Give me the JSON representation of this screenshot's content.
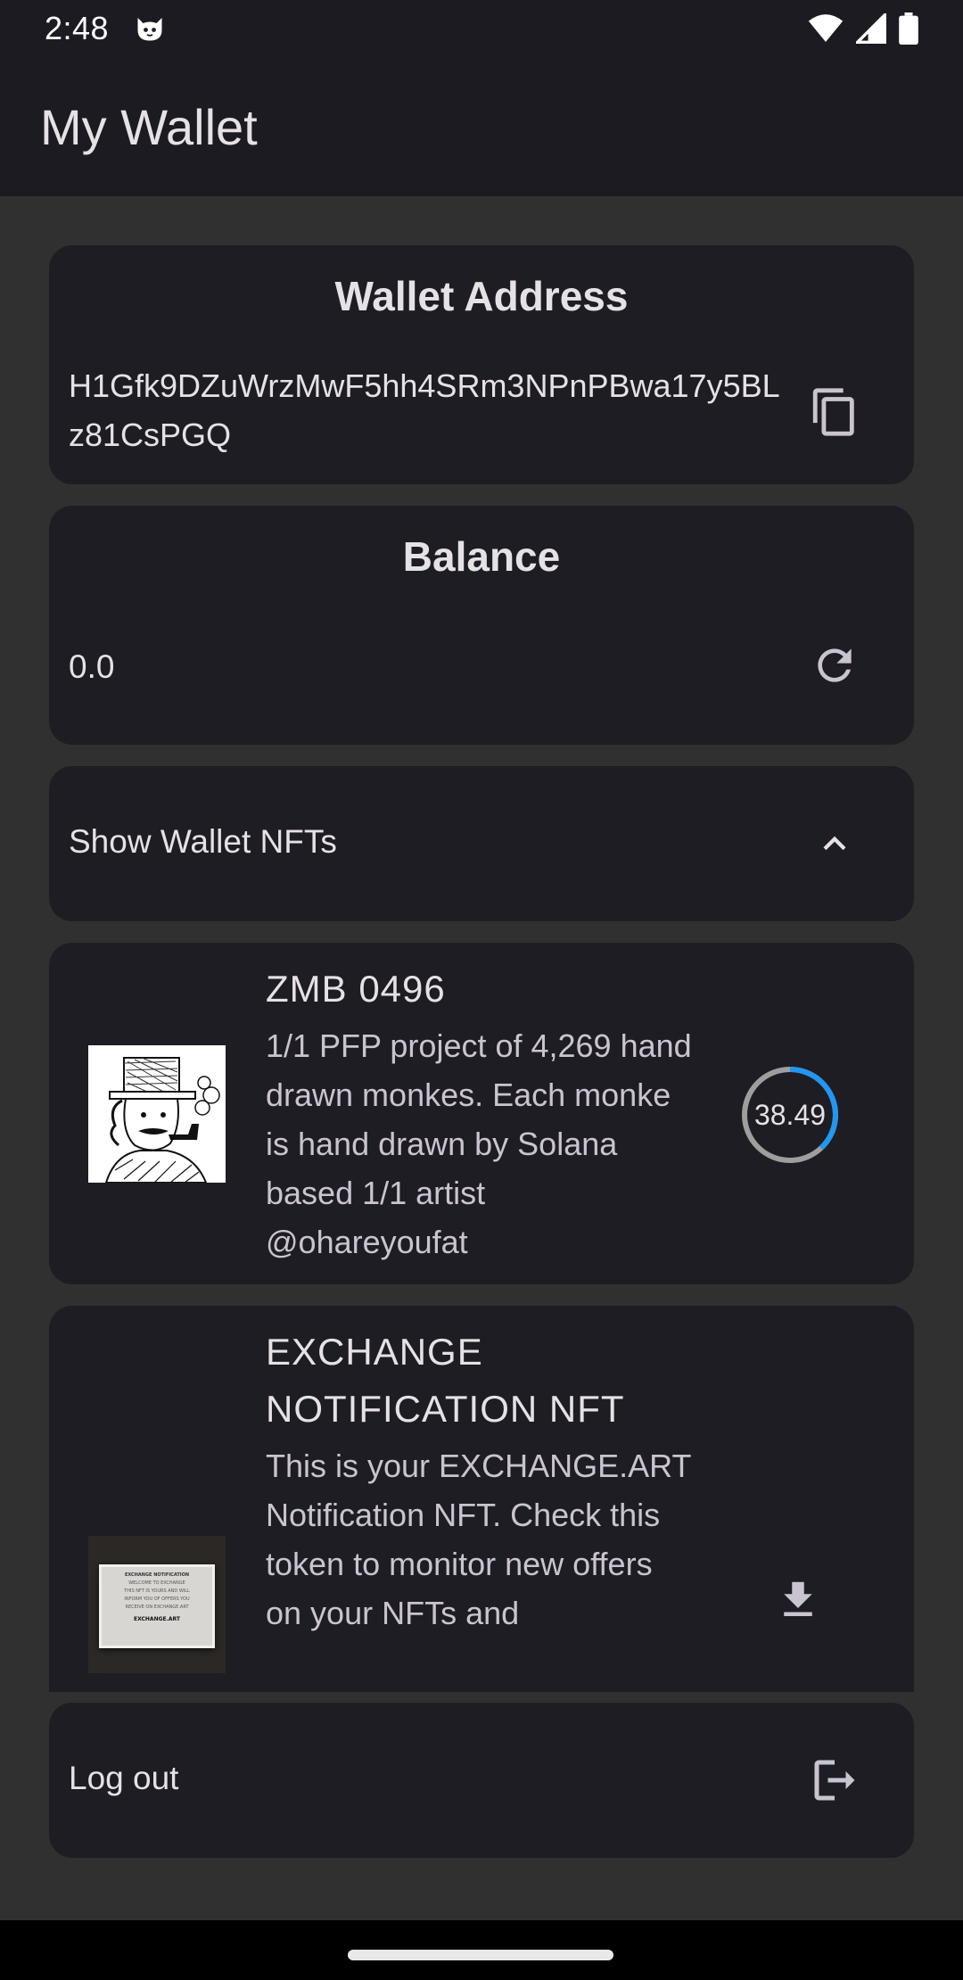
{
  "status_bar": {
    "time": "2:48",
    "icons": [
      "cat-face-icon",
      "wifi-icon",
      "signal-icon",
      "battery-icon"
    ]
  },
  "app_bar": {
    "title": "My Wallet"
  },
  "wallet_address": {
    "title": "Wallet Address",
    "address": "H1Gfk9DZuWrzMwF5hh4SRm3NPnPBwa17y5BLz81CsPGQ",
    "copy_icon": "copy-icon"
  },
  "balance": {
    "title": "Balance",
    "value": "0.0",
    "refresh_icon": "refresh-icon"
  },
  "nfts_toggle": {
    "label": "Show Wallet NFTs",
    "icon": "chevron-up-icon"
  },
  "nfts": [
    {
      "title": "ZMB 0496",
      "description": "1/1 PFP project of 4,269 hand drawn monkes. Each monke is hand drawn by Solana based 1/1 artist @ohareyoufat",
      "score": "38.49",
      "score_fraction": 0.38
    },
    {
      "title": "EXCHANGE NOTIFICATION NFT",
      "description": "This is your EXCHANGE.ART Notification NFT. Check this token to monitor new offers on your NFTs and",
      "thumb_lines": [
        "EXCHANGE NOTIFICATION",
        "WELCOME TO EXCHANGE",
        "THIS NFT IS YOURS AND WILL",
        "INFORM YOU OF OFFERS YOU",
        "RECEIVE ON EXCHANGE.ART",
        "EXCHANGE.ART"
      ],
      "action_icon": "download-icon"
    }
  ],
  "logout": {
    "label": "Log out",
    "icon": "logout-icon"
  },
  "colors": {
    "background": "#303030",
    "appbar": "#1c1b22",
    "card": "#1e1d23",
    "progress": "#2196f3"
  }
}
